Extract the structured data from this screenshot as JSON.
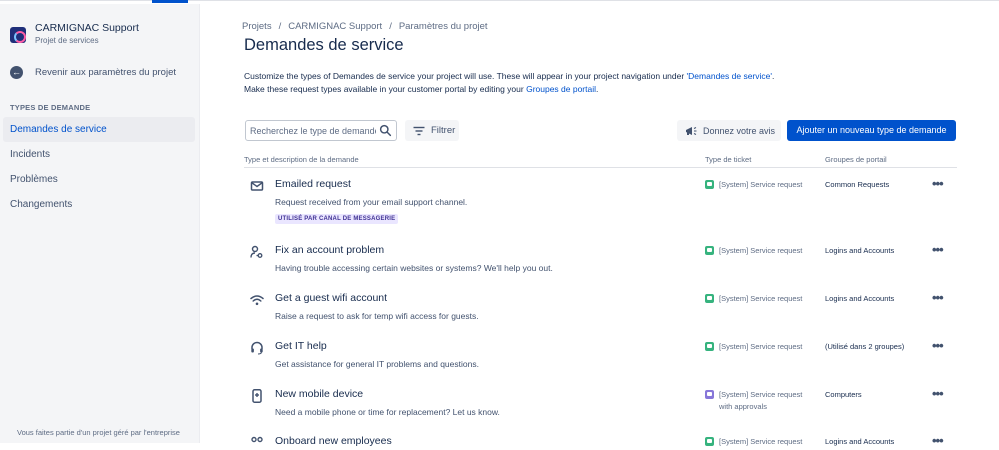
{
  "sidebar": {
    "project_name": "CARMIGNAC Support",
    "project_type": "Projet de services",
    "back_label": "Revenir aux paramètres du projet",
    "section_title": "TYPES DE DEMANDE",
    "items": [
      {
        "label": "Demandes de service",
        "active": true
      },
      {
        "label": "Incidents"
      },
      {
        "label": "Problèmes"
      },
      {
        "label": "Changements"
      }
    ],
    "footer": "Vous faites partie d'un projet géré par l'entreprise"
  },
  "breadcrumb": [
    "Projets",
    "/",
    "CARMIGNAC Support",
    "/",
    "Paramètres du projet"
  ],
  "page_title": "Demandes de service",
  "description": {
    "line1_text": "Customize the types of Demandes de service your project will use. These will appear in your project navigation under ",
    "line1_link": "'Demandes de service'",
    "line1_end": ".",
    "line2_text": "Make these request types available in your customer portal by editing your ",
    "line2_link": "Groupes de portail",
    "line2_end": "."
  },
  "search": {
    "placeholder": "Recherchez le type de demande"
  },
  "filter_label": "Filtrer",
  "feedback_label": "Donnez votre avis",
  "add_button_label": "Ajouter un nouveau type de demande",
  "table": {
    "headers": {
      "type": "Type et description de la demande",
      "ticket": "Type de ticket",
      "groups": "Groupes de portail"
    },
    "rows": [
      {
        "icon": "envelope-icon",
        "name": "Emailed request",
        "description": "Request received from your email support channel.",
        "badge": "UTILISÉ PAR CANAL DE MESSAGERIE",
        "ticket_line1": "[System] Service request",
        "ticket_line2": "",
        "ticket_color": "#36b37e",
        "groups": "Common Requests",
        "more": "•••"
      },
      {
        "icon": "user-key-icon",
        "name": "Fix an account problem",
        "description": "Having trouble accessing certain websites or systems? We'll help you out.",
        "ticket_line1": "[System] Service request",
        "ticket_line2": "",
        "ticket_color": "#36b37e",
        "groups": "Logins and Accounts",
        "more": "•••"
      },
      {
        "icon": "wifi-icon",
        "name": "Get a guest wifi account",
        "description": "Raise a request to ask for temp wifi access for guests.",
        "ticket_line1": "[System] Service request",
        "ticket_line2": "",
        "ticket_color": "#36b37e",
        "groups": "Logins and Accounts",
        "more": "•••"
      },
      {
        "icon": "headset-icon",
        "name": "Get IT help",
        "description": "Get assistance for general IT problems and questions.",
        "ticket_line1": "[System] Service request",
        "ticket_line2": "",
        "ticket_color": "#36b37e",
        "groups": "(Utilisé dans 2 groupes)",
        "more": "•••"
      },
      {
        "icon": "mobile-icon",
        "name": "New mobile device",
        "description": "Need a mobile phone or time for replacement? Let us know.",
        "ticket_line1": "[System] Service request",
        "ticket_line2": "with approvals",
        "ticket_color": "#8777d9",
        "groups": "Computers",
        "more": "•••"
      },
      {
        "icon": "people-icon",
        "name": "Onboard new employees",
        "description": "",
        "ticket_line1": "[System] Service request",
        "ticket_line2": "",
        "ticket_color": "#36b37e",
        "groups": "Logins and Accounts",
        "more": "•••"
      }
    ]
  }
}
